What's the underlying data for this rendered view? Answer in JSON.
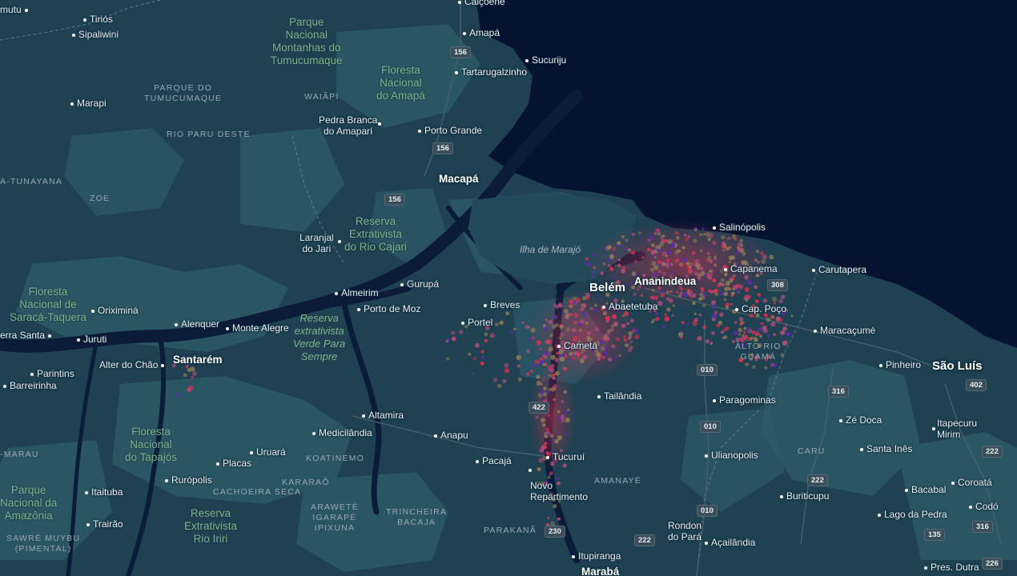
{
  "map": {
    "colors": {
      "ocean": "#061330",
      "land": "#1f4152",
      "forest": "#2a5563",
      "river": "#0b1c38",
      "heat_high": "#e0304e",
      "heat_mid": "#b04d78",
      "heat_purple": "#5a2ca8",
      "heat_low": "#8a7a55"
    },
    "places": [
      {
        "name": "mutu",
        "type": "place"
      },
      {
        "name": "Tiriós",
        "type": "place"
      },
      {
        "name": "Sipaliwini",
        "type": "place"
      },
      {
        "name": "Calçoene",
        "type": "place"
      },
      {
        "name": "Amapá",
        "type": "place"
      },
      {
        "name": "Sucuriju",
        "type": "place"
      },
      {
        "name": "Tartarugalzinho",
        "type": "place"
      },
      {
        "name": "Marapi",
        "type": "place"
      },
      {
        "name": "Pedra Branca\ndo Amaparí",
        "type": "place"
      },
      {
        "name": "Porto Grande",
        "type": "place"
      },
      {
        "name": "Macapá",
        "type": "city"
      },
      {
        "name": "Salinópolis",
        "type": "place"
      },
      {
        "name": "Laranjal\ndo Jari",
        "type": "place"
      },
      {
        "name": "Capanema",
        "type": "place"
      },
      {
        "name": "Carutapera",
        "type": "place"
      },
      {
        "name": "Belém",
        "type": "bigcity"
      },
      {
        "name": "Ananindeua",
        "type": "city"
      },
      {
        "name": "Almeirim",
        "type": "place"
      },
      {
        "name": "Gurupá",
        "type": "place"
      },
      {
        "name": "Oriximiná",
        "type": "place"
      },
      {
        "name": "Breves",
        "type": "place"
      },
      {
        "name": "Abaetetuba",
        "type": "place"
      },
      {
        "name": "Cap. Poço",
        "type": "place"
      },
      {
        "name": "Porto de Moz",
        "type": "place"
      },
      {
        "name": "Alenquer",
        "type": "place"
      },
      {
        "name": "Monte Alegre",
        "type": "place"
      },
      {
        "name": "Portel",
        "type": "place"
      },
      {
        "name": "Maracaçumé",
        "type": "place"
      },
      {
        "name": "erra Santa",
        "type": "place"
      },
      {
        "name": "Juruti",
        "type": "place"
      },
      {
        "name": "Cametá",
        "type": "place"
      },
      {
        "name": "Alter do Chão",
        "type": "place"
      },
      {
        "name": "Santarém",
        "type": "city"
      },
      {
        "name": "Pinheiro",
        "type": "place"
      },
      {
        "name": "São Luís",
        "type": "bigcity"
      },
      {
        "name": "Parintins",
        "type": "place"
      },
      {
        "name": "Barreirinha",
        "type": "place"
      },
      {
        "name": "Tailândia",
        "type": "place"
      },
      {
        "name": "Paragominas",
        "type": "place"
      },
      {
        "name": "Altamira",
        "type": "place"
      },
      {
        "name": "Zé Doca",
        "type": "place"
      },
      {
        "name": "Medicilândia",
        "type": "place"
      },
      {
        "name": "Anapu",
        "type": "place"
      },
      {
        "name": "Itapecuru\nMirim",
        "type": "place"
      },
      {
        "name": "Uruará",
        "type": "place"
      },
      {
        "name": "Placas",
        "type": "place"
      },
      {
        "name": "Pacajá",
        "type": "place"
      },
      {
        "name": "Tucuruí",
        "type": "place"
      },
      {
        "name": "Ulianopolis",
        "type": "place"
      },
      {
        "name": "Santa Inês",
        "type": "place"
      },
      {
        "name": "Rurópolis",
        "type": "place"
      },
      {
        "name": "Coroatá",
        "type": "place"
      },
      {
        "name": "Itaituba",
        "type": "place"
      },
      {
        "name": "Novo\nRepartimento",
        "type": "place"
      },
      {
        "name": "Buriticupu",
        "type": "place"
      },
      {
        "name": "Bacabal",
        "type": "place"
      },
      {
        "name": "Codó",
        "type": "place"
      },
      {
        "name": "Lago da Pedra",
        "type": "place"
      },
      {
        "name": "Trairão",
        "type": "place"
      },
      {
        "name": "Rondon\ndo Pará",
        "type": "place"
      },
      {
        "name": "Açailândia",
        "type": "place"
      },
      {
        "name": "Itupiranga",
        "type": "place"
      },
      {
        "name": "Pres. Dutra",
        "type": "place"
      },
      {
        "name": "Marabá",
        "type": "city"
      }
    ],
    "parks": [
      "Parque\nNacional\nMontanhas do\nTumucumaque",
      "Floresta\nNacional\ndo Amapá",
      "Reserva\nExtrativista\ndo Rio Cajari",
      "Floresta\nNacional de\nSaracá-Taquera",
      "Floresta\nNacional\ndo Tapajós",
      "Parque\nNacional da\nAmazônia",
      "Reserva\nExtrativista\nRio Iriri"
    ],
    "reserve_italic": "Reserva\nextrativista\nVerde Para\nSempre",
    "island": "Ilha de Marajó",
    "regions": [
      "PARQUE DO\nTUMUCUMAQUE",
      "WAIÃPI",
      "RIO PARU DESTE",
      "A-TUNAYANA",
      "ZOE",
      "-MARAU",
      "SAWRÉ MUYBU\n(PIMENTAL)",
      "CACHOEIRA SECA",
      "KOATINEMO",
      "KARARAÔ",
      "ARAWETÉ\nIGARAPÉ\nIPIXUNA",
      "TRINCHEIRA\nBACAJA",
      "PARAKANÃ",
      "AMANAYÉ",
      "ALTO RIO\nGUAMÁ",
      "CARU"
    ],
    "road_shields": [
      "156",
      "156",
      "156",
      "308",
      "010",
      "316",
      "402",
      "422",
      "010",
      "222",
      "222",
      "222",
      "010",
      "230",
      "135",
      "316",
      "226"
    ]
  }
}
